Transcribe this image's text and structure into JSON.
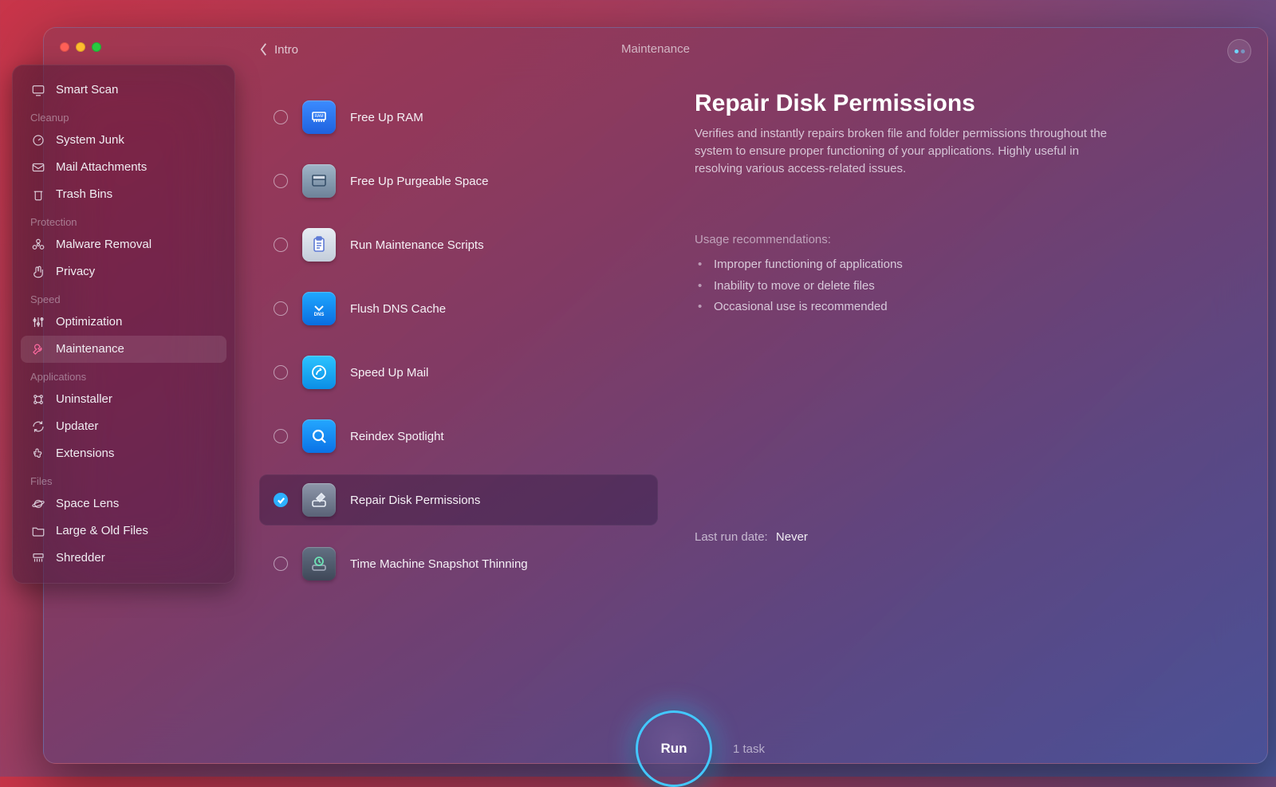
{
  "topbar": {
    "back_label": "Intro",
    "title": "Maintenance"
  },
  "sidebar": {
    "smart_scan": "Smart Scan",
    "sections": {
      "cleanup": {
        "label": "Cleanup",
        "items": [
          "System Junk",
          "Mail Attachments",
          "Trash Bins"
        ]
      },
      "protection": {
        "label": "Protection",
        "items": [
          "Malware Removal",
          "Privacy"
        ]
      },
      "speed": {
        "label": "Speed",
        "items": [
          "Optimization",
          "Maintenance"
        ]
      },
      "applications": {
        "label": "Applications",
        "items": [
          "Uninstaller",
          "Updater",
          "Extensions"
        ]
      },
      "files": {
        "label": "Files",
        "items": [
          "Space Lens",
          "Large & Old Files",
          "Shredder"
        ]
      }
    }
  },
  "tasks": [
    {
      "label": "Free Up RAM"
    },
    {
      "label": "Free Up Purgeable Space"
    },
    {
      "label": "Run Maintenance Scripts"
    },
    {
      "label": "Flush DNS Cache"
    },
    {
      "label": "Speed Up Mail"
    },
    {
      "label": "Reindex Spotlight"
    },
    {
      "label": "Repair Disk Permissions"
    },
    {
      "label": "Time Machine Snapshot Thinning"
    }
  ],
  "detail": {
    "title": "Repair Disk Permissions",
    "description": "Verifies and instantly repairs broken file and folder permissions throughout the system to ensure proper functioning of your applications. Highly useful in resolving various access-related issues.",
    "recommend_label": "Usage recommendations:",
    "recommendations": [
      "Improper functioning of applications",
      "Inability to move or delete files",
      "Occasional use is recommended"
    ],
    "lastrun_label": "Last run date:",
    "lastrun_value": "Never"
  },
  "run": {
    "button_label": "Run",
    "count_label": "1 task"
  }
}
